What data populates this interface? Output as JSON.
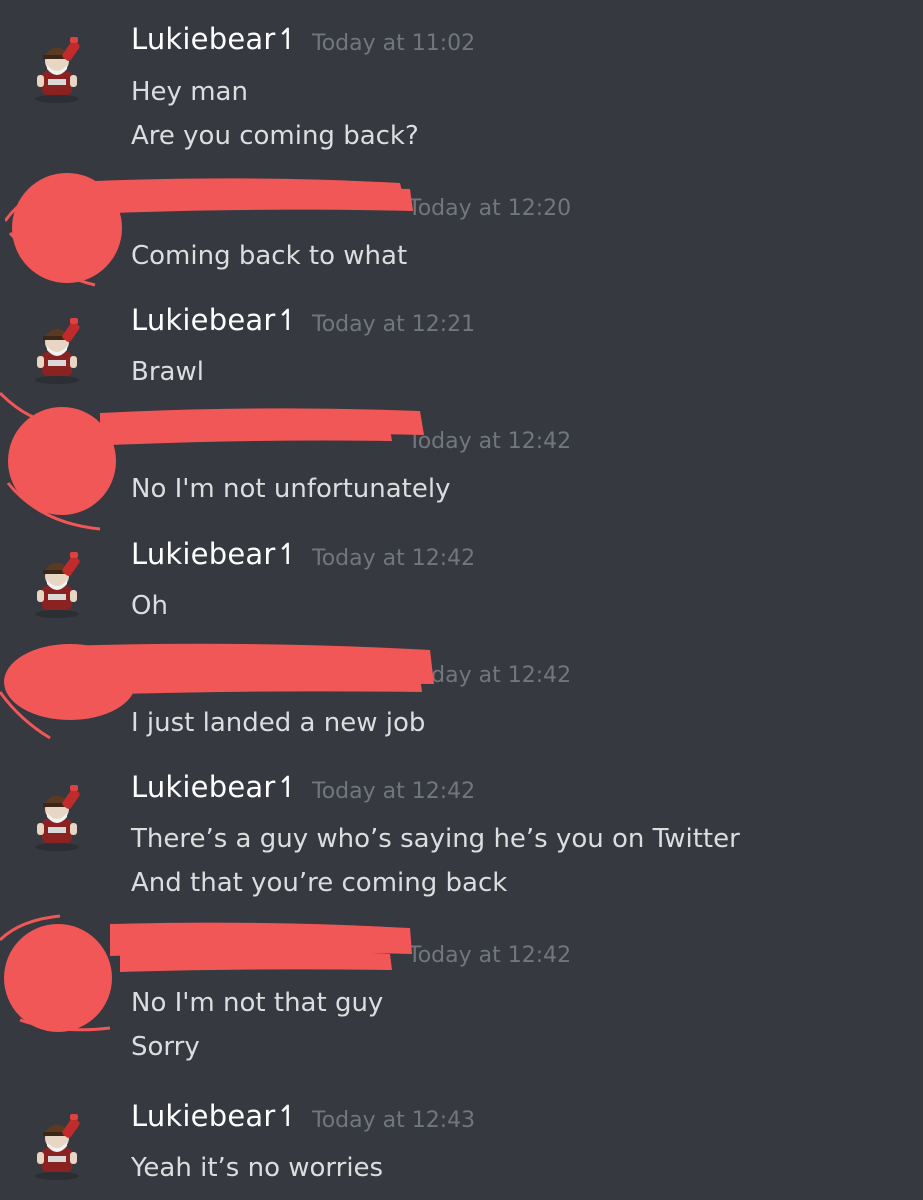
{
  "colors": {
    "background": "#36393f",
    "username": "#ffffff",
    "text": "#dcddde",
    "timestamp": "#72767d",
    "redaction": "#f25757"
  },
  "messages": [
    {
      "author": "Lukiebear↿",
      "timestamp": "Today at 11:02",
      "redacted": false,
      "lines": [
        "Hey man",
        "Are you coming back?"
      ]
    },
    {
      "author": "",
      "timestamp": "Today at 12:20",
      "redacted": true,
      "lines": [
        "Coming back to what"
      ]
    },
    {
      "author": "Lukiebear↿",
      "timestamp": "Today at 12:21",
      "redacted": false,
      "lines": [
        "Brawl"
      ]
    },
    {
      "author": "",
      "timestamp": "Today at 12:42",
      "redacted": true,
      "lines": [
        "No I'm not unfortunately"
      ]
    },
    {
      "author": "Lukiebear↿",
      "timestamp": "Today at 12:42",
      "redacted": false,
      "lines": [
        "Oh"
      ]
    },
    {
      "author": "",
      "timestamp": "Today at 12:42",
      "redacted": true,
      "lines": [
        "I just landed a new job"
      ]
    },
    {
      "author": "Lukiebear↿",
      "timestamp": "Today at 12:42",
      "redacted": false,
      "lines": [
        "There’s a guy who’s saying he’s you on Twitter",
        "And that you’re coming back"
      ]
    },
    {
      "author": "",
      "timestamp": "Today at 12:42",
      "redacted": true,
      "lines": [
        "No I'm not that guy",
        "Sorry"
      ]
    },
    {
      "author": "Lukiebear↿",
      "timestamp": "Today at 12:43",
      "redacted": false,
      "lines": [
        "Yeah it’s no worries"
      ]
    }
  ]
}
